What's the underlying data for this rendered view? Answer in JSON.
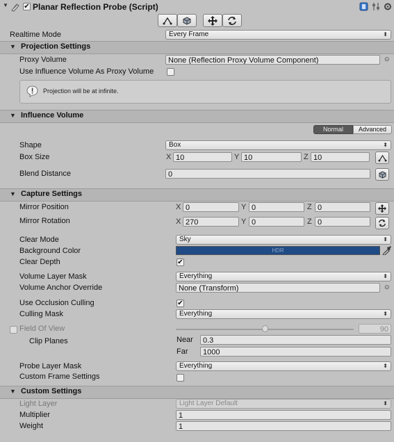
{
  "header": {
    "title": "Planar Reflection Probe (Script)"
  },
  "realtime_mode": {
    "label": "Realtime Mode",
    "value": "Every Frame"
  },
  "projection": {
    "title": "Projection Settings",
    "proxy_volume_label": "Proxy Volume",
    "proxy_volume_value": "None (Reflection Proxy Volume Component)",
    "use_influence_label": "Use Influence Volume As Proxy Volume",
    "info_text": "Projection will be at infinite."
  },
  "influence": {
    "title": "Influence Volume",
    "tab_normal": "Normal",
    "tab_advanced": "Advanced",
    "shape_label": "Shape",
    "shape_value": "Box",
    "box_size_label": "Box Size",
    "box_size": {
      "x": "10",
      "y": "10",
      "z": "10"
    },
    "blend_label": "Blend Distance",
    "blend_value": "0"
  },
  "axes": {
    "x": "X",
    "y": "Y",
    "z": "Z"
  },
  "capture": {
    "title": "Capture Settings",
    "mirror_position_label": "Mirror Position",
    "mirror_position": {
      "x": "0",
      "y": "0",
      "z": "0"
    },
    "mirror_rotation_label": "Mirror Rotation",
    "mirror_rotation": {
      "x": "270",
      "y": "0",
      "z": "0"
    },
    "clear_mode_label": "Clear Mode",
    "clear_mode_value": "Sky",
    "background_color_label": "Background Color",
    "background_color_text": "HDR",
    "background_color": "#1f4b86",
    "clear_depth_label": "Clear Depth",
    "clear_depth_checked": true,
    "volume_layer_mask_label": "Volume Layer Mask",
    "volume_layer_mask_value": "Everything",
    "volume_anchor_label": "Volume Anchor Override",
    "volume_anchor_value": "None (Transform)",
    "occlusion_label": "Use Occlusion Culling",
    "occlusion_checked": true,
    "culling_mask_label": "Culling Mask",
    "culling_mask_value": "Everything",
    "fov_label": "Field Of View",
    "fov_value": "90",
    "fov_slider_fraction": 0.5,
    "clip_planes_label": "Clip Planes",
    "near_label": "Near",
    "near_value": "0.3",
    "far_label": "Far",
    "far_value": "1000",
    "probe_layer_mask_label": "Probe Layer Mask",
    "probe_layer_mask_value": "Everything",
    "custom_frame_label": "Custom Frame Settings"
  },
  "custom": {
    "title": "Custom Settings",
    "light_layer_label": "Light Layer",
    "light_layer_value": "Light Layer Default",
    "multiplier_label": "Multiplier",
    "multiplier_value": "1",
    "weight_label": "Weight",
    "weight_value": "1"
  }
}
